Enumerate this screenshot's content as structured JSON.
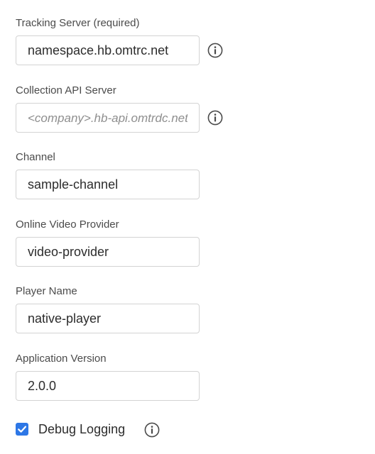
{
  "fields": [
    {
      "label": "Tracking Server (required)",
      "value": "namespace.hb.omtrc.net",
      "placeholder": "",
      "icon": "info-icon"
    },
    {
      "label": "Collection API Server",
      "value": "",
      "placeholder": "<company>.hb-api.omtrdc.net",
      "icon": "info-icon"
    },
    {
      "label": "Channel",
      "value": "sample-channel",
      "placeholder": ""
    },
    {
      "label": "Online Video Provider",
      "value": "video-provider",
      "placeholder": ""
    },
    {
      "label": "Player Name",
      "value": "native-player",
      "placeholder": ""
    },
    {
      "label": "Application Version",
      "value": "2.0.0",
      "placeholder": ""
    }
  ],
  "debug": {
    "label": "Debug Logging",
    "checked": true,
    "icon": "info-icon"
  },
  "colors": {
    "checkbox_accent": "#2d77e6",
    "input_border": "#d3d3d3",
    "icon_stroke": "#4a4a4a"
  }
}
